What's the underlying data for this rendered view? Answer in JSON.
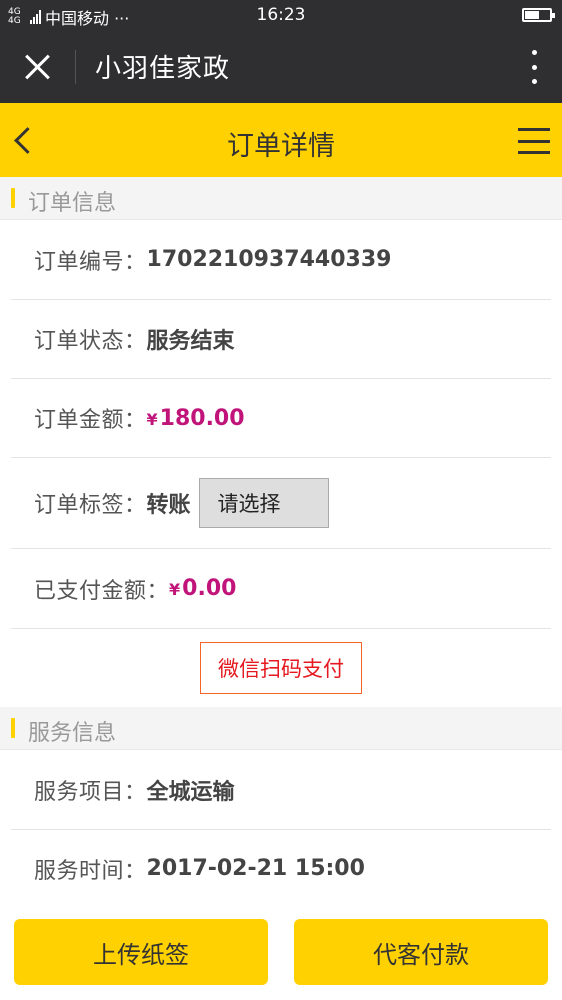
{
  "status_bar": {
    "network": "4G 4G",
    "carrier": "中国移动 ···",
    "time": "16:23",
    "battery_level": 0.6
  },
  "wechat_bar": {
    "title": "小羽佳家政"
  },
  "header": {
    "title": "订单详情"
  },
  "order_section": {
    "title": "订单信息",
    "order_no_label": "订单编号：",
    "order_no": "1702210937440339",
    "status_label": "订单状态：",
    "status": "服务结束",
    "amount_label": "订单金额：",
    "amount_currency": "¥",
    "amount": "180.00",
    "tag_label": "订单标签：",
    "tag": "转账",
    "tag_select": "请选择",
    "paid_label": "已支付金额：",
    "paid_currency": "¥",
    "paid": "0.00",
    "pay_button": "微信扫码支付"
  },
  "service_section": {
    "title": "服务信息",
    "item_label": "服务项目：",
    "item": "全城运输",
    "time_label": "服务时间：",
    "time": "2017-02-21 15:00"
  },
  "footer": {
    "upload_button": "上传纸签",
    "proxy_pay_button": "代客付款"
  },
  "colors": {
    "accent": "#ffd100",
    "dark": "#2f2f31",
    "money": "#c0147a",
    "pay_border": "#f26522",
    "pay_text": "#e5191f"
  },
  "icons": [
    "close-icon",
    "more-icon",
    "back-icon",
    "menu-icon",
    "signal-icon",
    "battery-icon"
  ]
}
